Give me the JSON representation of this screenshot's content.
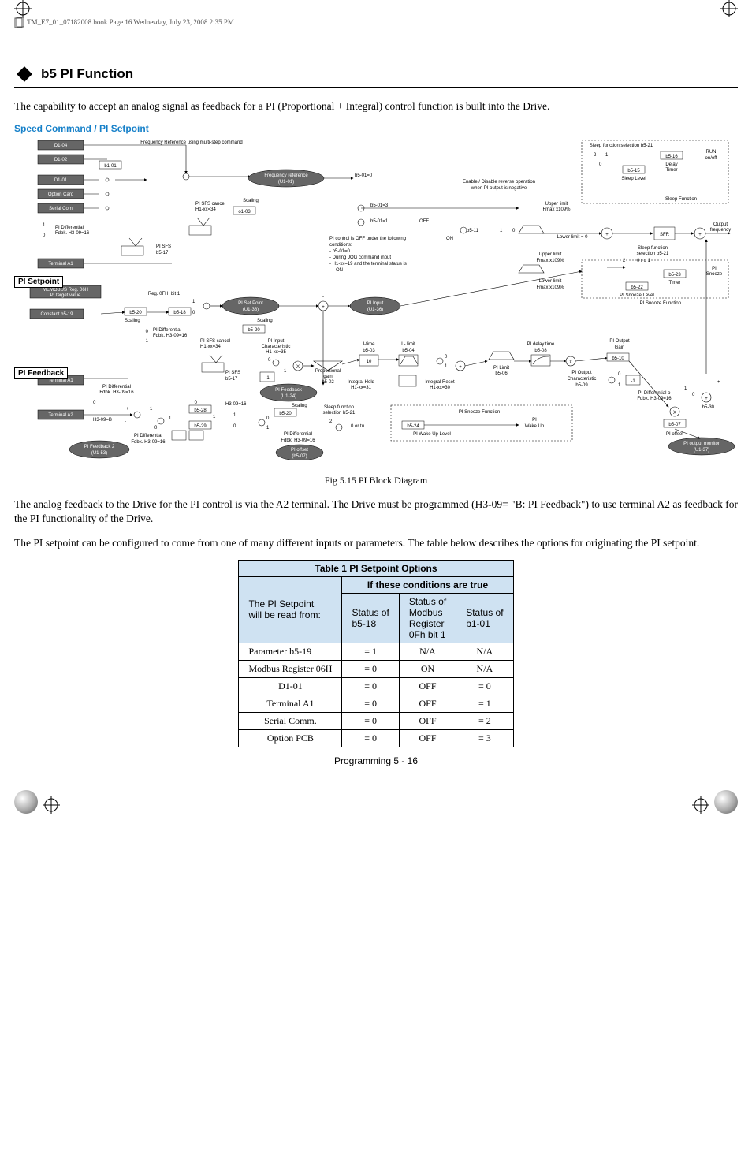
{
  "header_note": "TM_E7_01_07182008.book  Page 16  Wednesday, July 23, 2008  2:35 PM",
  "section": {
    "title": "b5 PI Function"
  },
  "para1": "The capability to accept an analog signal as feedback for a PI (Proportional + Integral) control function is built into the Drive.",
  "subheading": "Speed Command / PI Setpoint",
  "fig_caption": "Fig 5.15  PI Block Diagram",
  "para2": "The analog feedback to the Drive for the PI control is via the A2 terminal. The Drive must be programmed (H3-09= \"B: PI Feedback\") to use terminal A2 as feedback for the PI functionality of the Drive.",
  "para3": "The PI setpoint can be configured to come from one of many different inputs or parameters. The table below describes the options for originating the PI setpoint.",
  "table": {
    "title": "Table 1 PI Setpoint Options",
    "group_header": "If these conditions are true",
    "row_header": [
      "The PI Setpoint",
      "will be read from:"
    ],
    "col_headers": [
      [
        "Status of",
        "b5-18"
      ],
      [
        "Status of",
        "Modbus",
        "Register",
        "0Fh bit 1"
      ],
      [
        "Status of",
        "b1-01"
      ]
    ],
    "rows": [
      {
        "label": "Parameter b5-19",
        "c1": "= 1",
        "c2": "N/A",
        "c3": "N/A"
      },
      {
        "label": "Modbus Register 06H",
        "c1": "= 0",
        "c2": "ON",
        "c3": "N/A"
      },
      {
        "label": "D1-01",
        "c1": "= 0",
        "c2": "OFF",
        "c3": "= 0"
      },
      {
        "label": "Terminal A1",
        "c1": "= 0",
        "c2": "OFF",
        "c3": "= 1"
      },
      {
        "label": "Serial Comm.",
        "c1": "= 0",
        "c2": "OFF",
        "c3": "= 2"
      },
      {
        "label": "Option PCB",
        "c1": "= 0",
        "c2": "OFF",
        "c3": "= 3"
      }
    ]
  },
  "footer": "Programming   5 - 16",
  "diagram": {
    "setpoint_box": "PI Setpoint",
    "feedback_box": "PI Feedback",
    "left_inputs": [
      "D1-04",
      "D1-02",
      "D1-01",
      "Option Card",
      "Serial Com",
      "Terminal A1"
    ],
    "left_labels": {
      "b1-01": "b1-01",
      "pi_sfs_cancel": "PI SFS cancel\nH1-xx=34",
      "pi_diff_fdbk": "PI Differential\nFdbk. H3-09=16",
      "pi_sfs": "PI SFS\nb5-17"
    },
    "freq_ref_multi": "Frequency Reference\nusing multi-step\ncommand",
    "freq_ref_u1": "Frequency reference\n(U1-01)",
    "b5_01_0": "b5-01=0",
    "enable_disable": "Enable / Disable reverse operation\nwhen PI output is negative",
    "scaling": "Scaling",
    "o1_03": "o1-03",
    "pi_off_conditions": "PI control is OFF under the following\nconditions:\n- b5-01=0\n- During JOG command  input\n- H1-xx=19 and the terminal status is\n  ON",
    "b5_01_3": "b5-01=3",
    "b5_01_1": "b5-01=1",
    "upper_limit": "Upper limit\nFmax x109%",
    "upper_limit2": "Upper limit\nFmax x109%",
    "lower_limit": "Lower limit = 0",
    "lower_limit2": "Lower limit\nFmax x109%",
    "off": "OFF",
    "on": "ON",
    "sfr": "SFR",
    "output_freq": "Output\nfrequency",
    "sleep_sel": "Sleep function\nselection b5-21",
    "sleep_sel2": "Sleep function\nselection b5-21",
    "b5_15": "b5-15",
    "sleep_level": "Sleep Level",
    "b5_16": "b5-16",
    "delay_timer": "Delay\nTimer",
    "run_onoff": "RUN\non/off",
    "sleep_function": "Sleep Function",
    "pi_b5_22": "PI\nSnooze",
    "b5_23": "b5-23",
    "timer": "Timer",
    "b5_22": "b5-22",
    "pi_snooze_level": "PI Snooze Level",
    "pi_snooze_function": "PI Snooze Function",
    "memobus": "MEMOBUS Reg. 06H\nPI target value",
    "constant_b5_19": "Constant b5-19",
    "reg_0fh": "Reg. 0FH, bit 1",
    "b5_20": "b5-20",
    "b5_18": "b5-18",
    "pi_set_point": "PI Set Point\n(U1-38)",
    "pi_input": "PI Input\n(U1-36)",
    "b5_20b": "b5-20",
    "pi_input_char": "PI Input\nCharacteristic\nH1-xx=35",
    "i_time": "I-time\nb5-03",
    "i_limit": "I - limit\nb5-04",
    "pi_delay": "PI delay time\nb5-08",
    "pi_output_gain": "PI Output\nGain",
    "b5_10": "b5-10",
    "prop_gain": "Proportional\ngain\nb5-02",
    "integral_hold": "Integral Hold\nH1-xx=31",
    "integral_reset": "Integral Reset\nH1-xx=30",
    "pi_limit": "PI Limit\nb5-06",
    "pi_output_char": "PI Output\nCharacteristic\nb5-09",
    "terminal_a1b": "Terminal A1",
    "terminal_a2": "Terminal A2",
    "h3_09b": "H3-09=B",
    "pi_feedback_u1": "PI Feedback\n(U1-24)",
    "b5_20c": "b5-20",
    "b5_28": "b5-28",
    "b5_29": "b5-29",
    "h3_09_16": "H3-09=16",
    "pi_diff_fdbk2": "PI Differential\nFdbk. H3-09=16",
    "pi_diff_fdbk3": "PI Differential\nFdbk. H3-09=16",
    "pi_differential": "PI Differential",
    "pi_offset": "PI offset\n(b5-07)",
    "pi_fb2": "PI Feedback 2\n(U1-53)",
    "zero_ortu": "0 or tu",
    "sleep_sel3": "Sleep function\nselection b5-21",
    "pi_snooze2": "PI Snooze Function",
    "b5_24": "b5-24",
    "pi_wakeup_level": "PI Wake Up Level",
    "pi_wakeup": "PI\nWake Up",
    "pi_diff_o": "PI Differential  o\nFdbk. H3-09=16",
    "b5_07": "b5-07",
    "pi_offset2": "PI offset",
    "b5_30": "b5-30",
    "pi_out_mon": "PI output monitor\n(U1-37)",
    "zero": "0",
    "one": "1",
    "two": "2",
    "plus": "+",
    "minus": "-",
    "x": "X",
    "ten": "10",
    "neg1": "-1",
    "zero_one": "0  1",
    "two_far": "2"
  }
}
